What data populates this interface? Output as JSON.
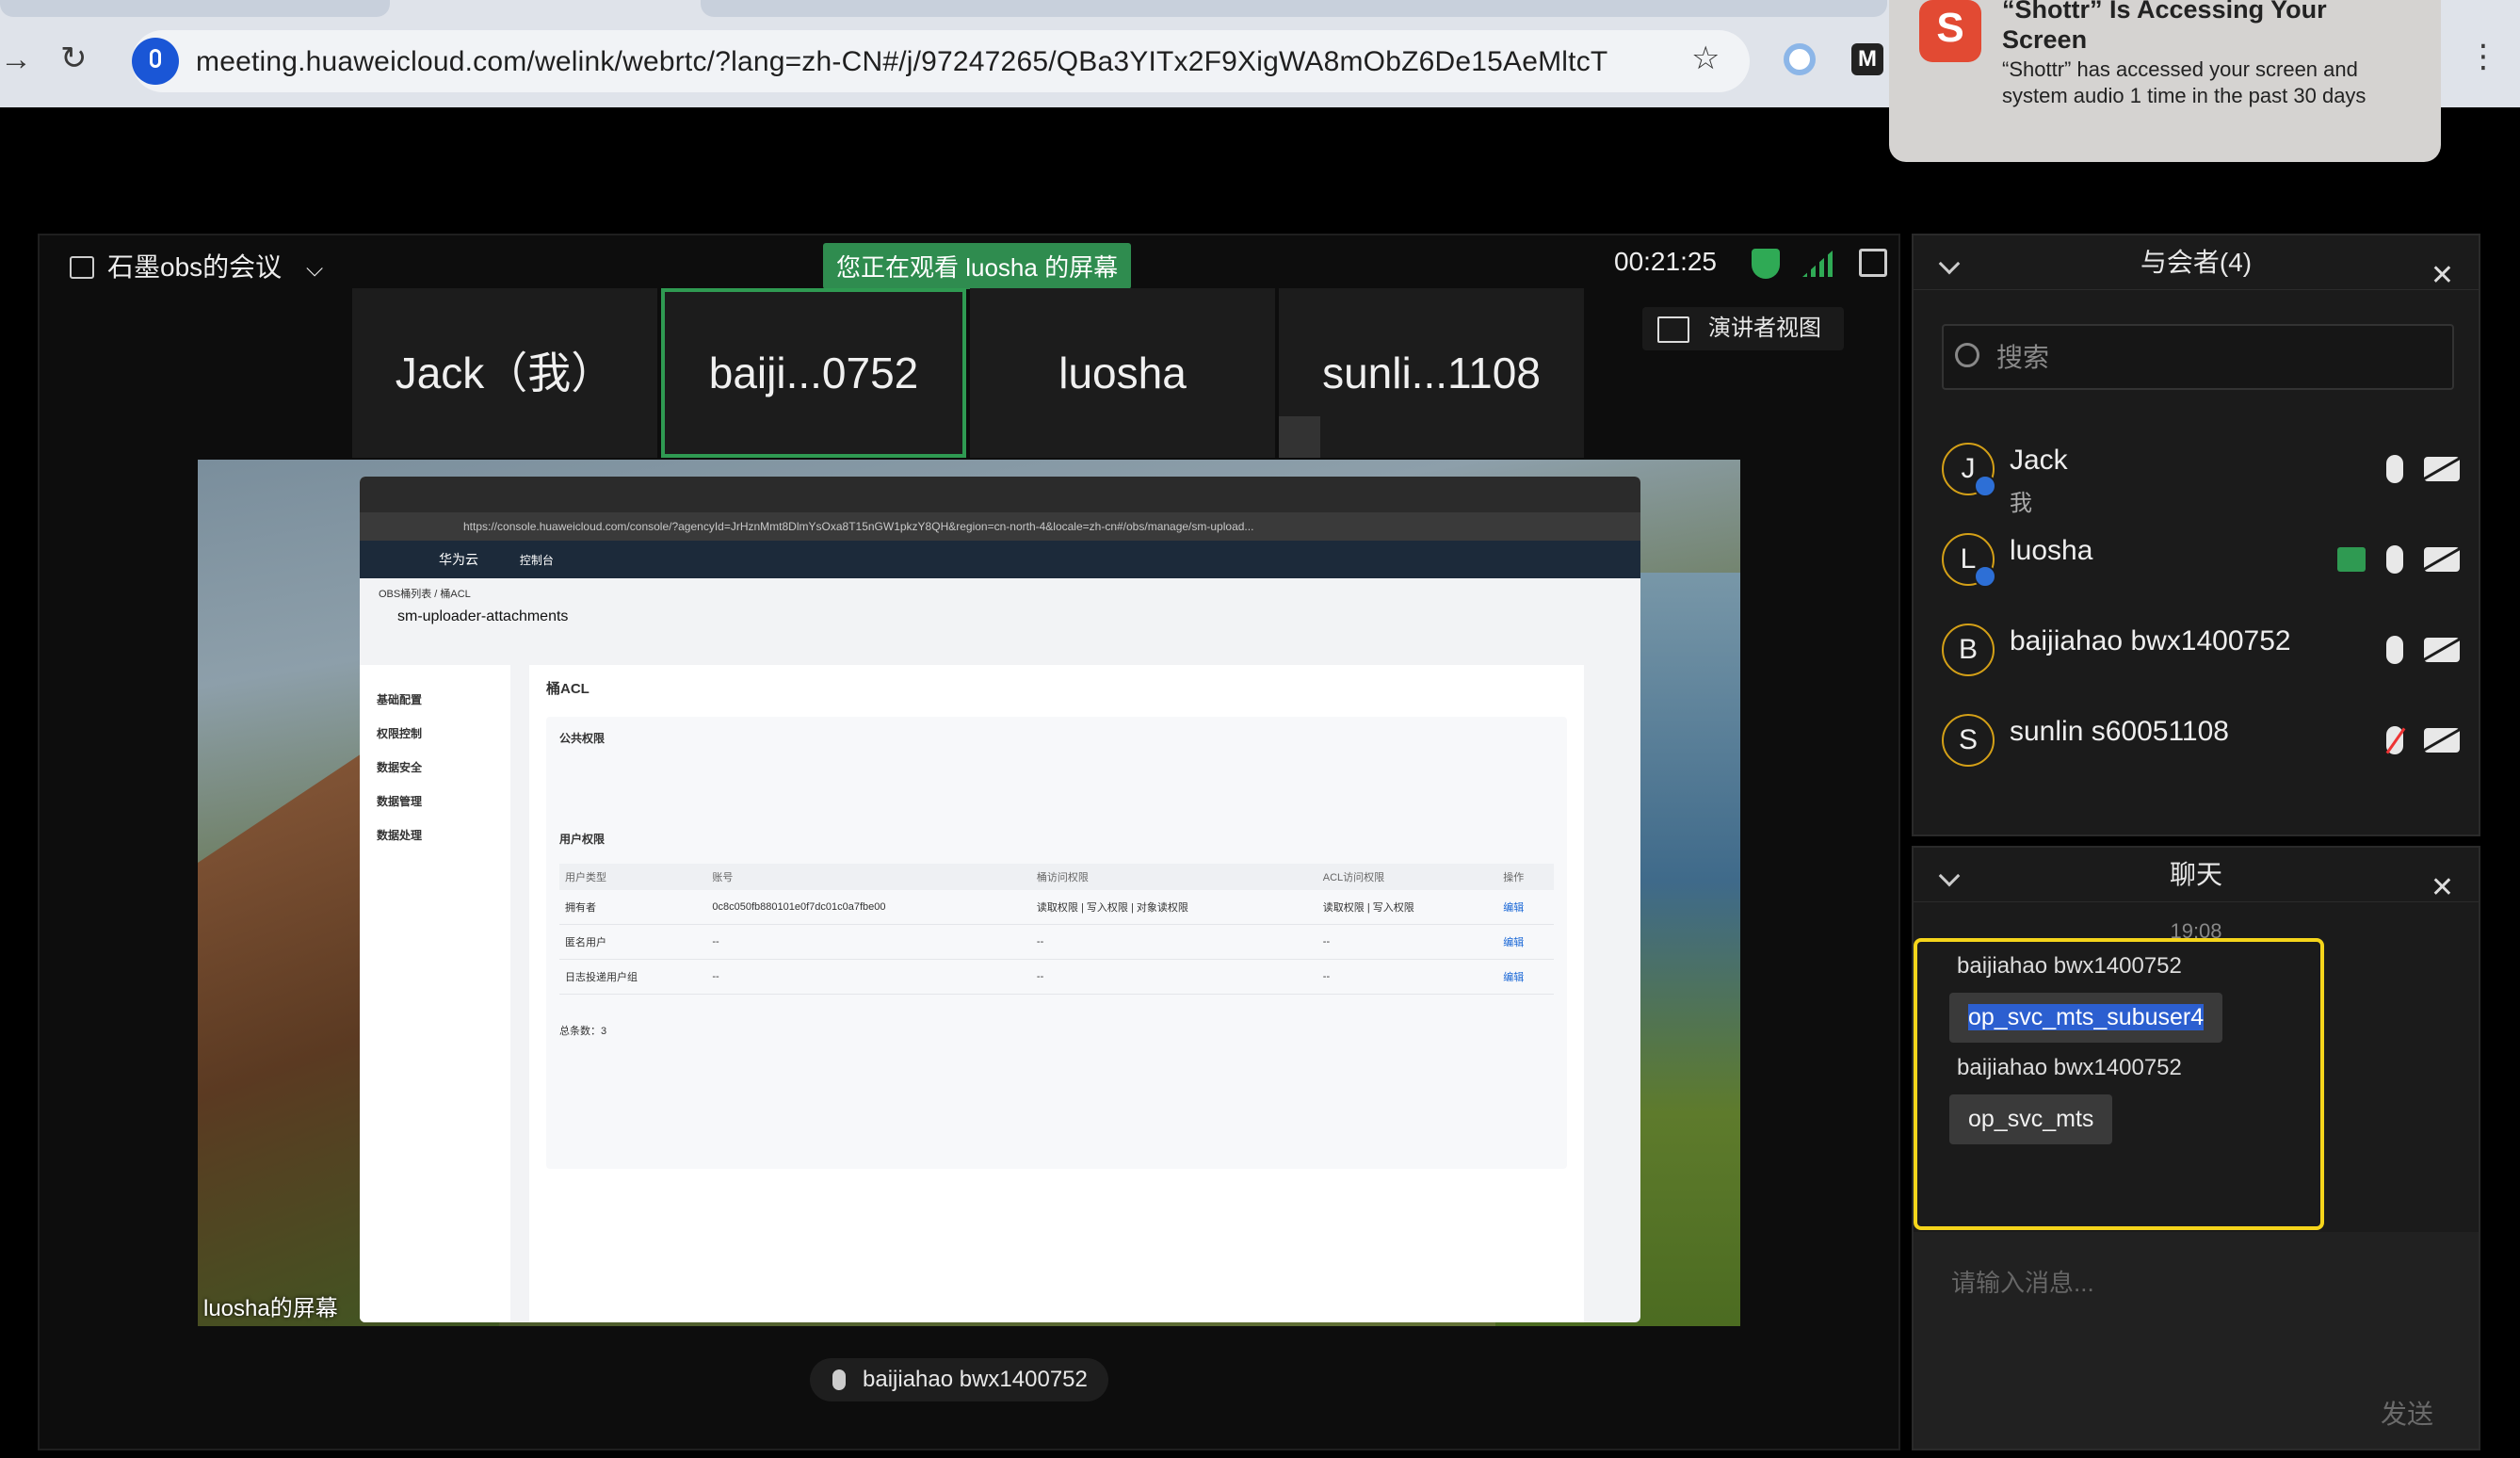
{
  "browser": {
    "url": "meeting.huaweicloud.com/welink/webrtc/?lang=zh-CN#/j/97247265/QBa3YITx2F9XigWA8mObZ6De15AeMltcT",
    "bookmark_icon": "star-icon",
    "extension_label": "M"
  },
  "notification": {
    "app_letter": "S",
    "title": "“Shottr” Is Accessing Your Screen",
    "body": "“Shottr” has accessed your screen and system audio 1 time in the past 30 days"
  },
  "meeting": {
    "title": "石墨obs的会议",
    "watching_banner": "您正在观看 luosha 的屏幕",
    "timer": "00:21:25",
    "presenter_view_label": "演讲者视图",
    "tiles": [
      "Jack（我）",
      "baiji...0752",
      "luosha",
      "sunli...1108"
    ],
    "share_label": "luosha的屏幕",
    "speaking": "baijiahao bwx1400752"
  },
  "shared_console": {
    "url": "https://console.huaweicloud.com/console/?agencyId=JrHznMmt8DlmYsOxa8T15nGW1pkzY8QH&region=cn-north-4&locale=zh-cn#/obs/manage/sm-upload...",
    "brand": "华为云",
    "nav": "控制台",
    "breadcrumb": "OBS桶列表 / 桶ACL",
    "bucket": "sm-uploader-attachments",
    "section": "桶ACL",
    "public_perm": "公共权限",
    "user_perm": "用户权限",
    "side": {
      "g1": "基础配置",
      "g2": "权限控制",
      "g3": "数据安全",
      "g4": "数据管理",
      "g5": "数据处理"
    },
    "table_headers": [
      "用户类型",
      "账号",
      "桶访问权限",
      "ACL访问权限",
      "操作"
    ],
    "rows": [
      [
        "拥有者",
        "0c8c050fb880101e0f7dc01c0a7fbe00",
        "读取权限 | 写入权限 | 对象读权限",
        "读取权限 | 写入权限",
        "编辑"
      ],
      [
        "匿名用户",
        "--",
        "--",
        "--",
        "编辑"
      ],
      [
        "日志投递用户组",
        "--",
        "--",
        "--",
        "编辑"
      ]
    ],
    "total": "总条数：3"
  },
  "participants": {
    "header": "与会者(4)",
    "search_placeholder": "搜索",
    "list": [
      {
        "initial": "J",
        "name": "Jack",
        "sub": "我"
      },
      {
        "initial": "L",
        "name": "luosha",
        "sub": ""
      },
      {
        "initial": "B",
        "name": "baijiahao bwx1400752",
        "sub": ""
      },
      {
        "initial": "S",
        "name": "sunlin s60051108",
        "sub": ""
      }
    ]
  },
  "chat": {
    "header": "聊天",
    "time": "19:08",
    "messages": [
      {
        "from": "baijiahao bwx1400752",
        "text": "op_svc_mts_subuser4"
      },
      {
        "from": "baijiahao bwx1400752",
        "text": "op_svc_mts"
      }
    ],
    "input_placeholder": "请输入消息...",
    "send_label": "发送"
  }
}
